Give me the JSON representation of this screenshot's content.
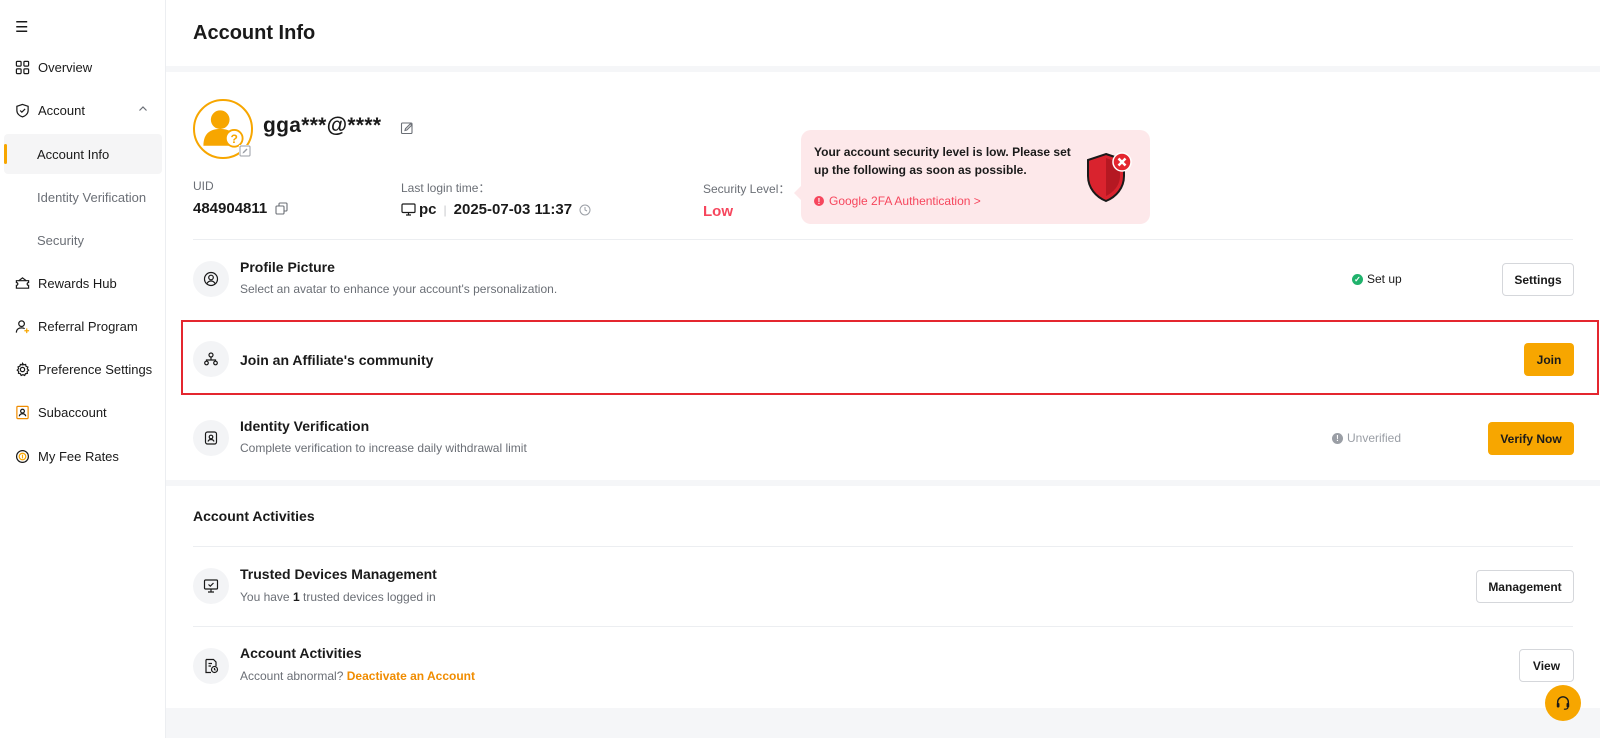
{
  "sidebar": {
    "items": [
      {
        "label": "Overview",
        "icon": "grid-icon"
      },
      {
        "label": "Account",
        "icon": "shield-icon"
      },
      {
        "label": "Rewards Hub",
        "icon": "ticket-icon"
      },
      {
        "label": "Referral Program",
        "icon": "user-plus-icon"
      },
      {
        "label": "Preference Settings",
        "icon": "gear-icon"
      },
      {
        "label": "Subaccount",
        "icon": "id-card-icon"
      },
      {
        "label": "My Fee Rates",
        "icon": "coin-icon"
      }
    ],
    "account_subitems": [
      {
        "label": "Account Info"
      },
      {
        "label": "Identity Verification"
      },
      {
        "label": "Security"
      }
    ]
  },
  "header": {
    "title": "Account Info"
  },
  "profile": {
    "username": "gga***@****",
    "uid_label": "UID",
    "uid": "484904811",
    "last_login_label": "Last login time：",
    "device": "pc",
    "last_login_time": "2025-07-03 11:37",
    "security_label": "Security Level：",
    "security_level": "Low"
  },
  "security_tooltip": {
    "text": "Your account security level is low. Please set up the following as soon as possible.",
    "link": "Google 2FA Authentication >"
  },
  "rows": {
    "profile_picture": {
      "title": "Profile Picture",
      "desc": "Select an avatar to enhance your account's personalization.",
      "status": "Set up",
      "button": "Settings"
    },
    "affiliate": {
      "title": "Join an Affiliate's community",
      "button": "Join"
    },
    "identity": {
      "title": "Identity Verification",
      "desc": "Complete verification to increase daily withdrawal limit",
      "status": "Unverified",
      "button": "Verify Now"
    }
  },
  "activities": {
    "section_title": "Account Activities",
    "trusted": {
      "title": "Trusted Devices Management",
      "desc_prefix": "You have",
      "count": "1",
      "desc_suffix": "trusted devices logged in",
      "button": "Management"
    },
    "account": {
      "title": "Account Activities",
      "desc": "Account abnormal?",
      "link": "Deactivate an Account",
      "button": "View"
    }
  },
  "colors": {
    "accent": "#f7a600",
    "danger": "#f6465d",
    "success": "#20b26c",
    "link": "#f08c00"
  }
}
